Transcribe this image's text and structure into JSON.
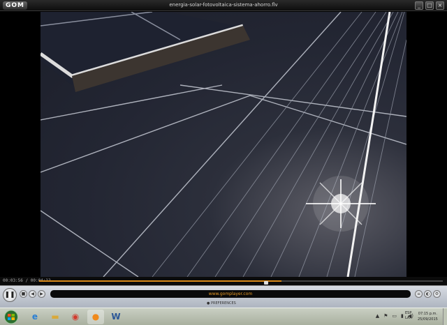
{
  "window": {
    "app_logo": "GOM",
    "title": "energia-solar-fotovoltaica-sistema-ahorro.flv",
    "buttons": [
      "minimize-icon",
      "maximize-icon",
      "close-icon"
    ]
  },
  "player": {
    "timecode": "00:03:56 / 00:04:12",
    "progress_fraction": 0.6,
    "info_text": "www.gomplayer.com",
    "preferences_label": "PREFERENCES",
    "play_state": "playing"
  },
  "taskbar": {
    "pinned": [
      {
        "name": "ie-icon",
        "glyph": "e",
        "color": "#2a7fd4"
      },
      {
        "name": "folder-icon",
        "glyph": "▬",
        "color": "#d9a93a"
      },
      {
        "name": "chrome-icon",
        "glyph": "◉",
        "color": "#d23b2e"
      },
      {
        "name": "gom-icon",
        "glyph": "●",
        "color": "#f08a1c"
      },
      {
        "name": "word-icon",
        "glyph": "W",
        "color": "#2b5797"
      }
    ],
    "language": "ESP",
    "language_sub": "LAA",
    "time": "07:15 p.m.",
    "date": "25/09/2015"
  },
  "colors": {
    "accent": "#e89a25",
    "titlebar": "#1a1a1a"
  }
}
